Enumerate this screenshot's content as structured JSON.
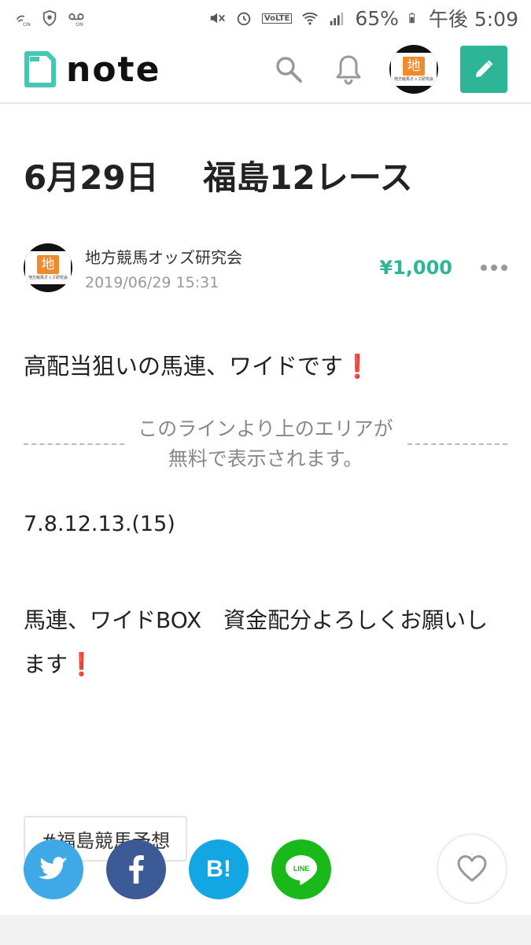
{
  "status_bar": {
    "battery": "65%",
    "time": "午後 5:09",
    "volte": "VoLTE",
    "icons": [
      "wifi-calling-icon",
      "shield-icon",
      "voicemail-icon",
      "mute-icon",
      "alarm-icon",
      "volte-icon",
      "wifi-icon",
      "signal-icon",
      "battery-icon"
    ]
  },
  "header": {
    "brand": "note",
    "avatar_kanji": "地",
    "avatar_caption": "地方競馬オッズ研究会",
    "icons": [
      "note-logo-icon",
      "search-icon",
      "bell-icon",
      "pencil-icon"
    ],
    "accent": "#2cb696"
  },
  "article": {
    "title": "6月29日　 福島12レース",
    "author": "地方競馬オッズ研究会",
    "date": "2019/06/29 15:31",
    "price": "¥1,000",
    "lead": "高配当狙いの馬連、ワイドです",
    "exclamation": "❗",
    "paywall_line1": "このラインより上のエリアが",
    "paywall_line2": "無料で表示されます。",
    "numbers": "7.8.12.13.(15)",
    "paragraph": "馬連、ワイドBOX　資金配分よろしくお願いします",
    "hashtag": "#福島競馬予想"
  },
  "share": {
    "twitter_color": "#3fa9e8",
    "facebook_color": "#3b5a96",
    "hatena_color": "#12a7e3",
    "line_color": "#19b919",
    "hatena_label": "B!",
    "line_label": "LINE",
    "icons": [
      "twitter-icon",
      "facebook-icon",
      "hatena-bookmark-icon",
      "line-icon",
      "heart-icon"
    ]
  }
}
